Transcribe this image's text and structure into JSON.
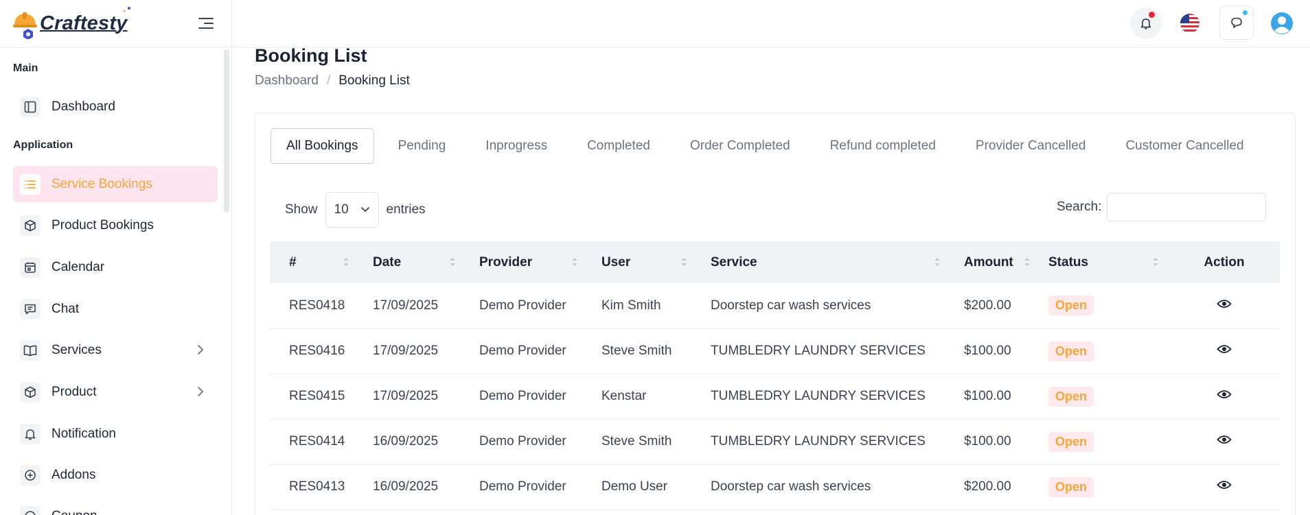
{
  "app": {
    "logo_text": "Craftesty"
  },
  "sidebar": {
    "sections": [
      {
        "label": "Main"
      },
      {
        "label": "Application"
      }
    ],
    "items": [
      {
        "label": "Dashboard",
        "icon": "layout-icon"
      },
      {
        "label": "Service Bookings",
        "icon": "list-icon",
        "active": true
      },
      {
        "label": "Product Bookings",
        "icon": "box-icon"
      },
      {
        "label": "Calendar",
        "icon": "calendar-icon"
      },
      {
        "label": "Chat",
        "icon": "chat-icon"
      },
      {
        "label": "Services",
        "icon": "book-icon",
        "has_children": true
      },
      {
        "label": "Product",
        "icon": "box-icon",
        "has_children": true
      },
      {
        "label": "Notification",
        "icon": "bell-icon"
      },
      {
        "label": "Addons",
        "icon": "plus-circle-icon"
      },
      {
        "label": "Coupon",
        "icon": "coupon-icon"
      }
    ]
  },
  "page": {
    "title": "Booking List",
    "breadcrumb": {
      "home": "Dashboard",
      "separator": "/",
      "current": "Booking List"
    }
  },
  "tabs": [
    "All Bookings",
    "Pending",
    "Inprogress",
    "Completed",
    "Order Completed",
    "Refund completed",
    "Provider Cancelled",
    "Customer Cancelled"
  ],
  "table_controls": {
    "show_label": "Show",
    "page_size": "10",
    "entries_label": "entries",
    "search_label": "Search:"
  },
  "table": {
    "columns": [
      "#",
      "Date",
      "Provider",
      "User",
      "Service",
      "Amount",
      "Status",
      "Action"
    ],
    "rows": [
      {
        "id": "RES0418",
        "date": "17/09/2025",
        "provider": "Demo Provider",
        "user": "Kim Smith",
        "service": "Doorstep car wash services",
        "amount": "$200.00",
        "status": "Open"
      },
      {
        "id": "RES0416",
        "date": "17/09/2025",
        "provider": "Demo Provider",
        "user": "Steve Smith",
        "service": "TUMBLEDRY LAUNDRY SERVICES",
        "amount": "$100.00",
        "status": "Open"
      },
      {
        "id": "RES0415",
        "date": "17/09/2025",
        "provider": "Demo Provider",
        "user": "Kenstar",
        "service": "TUMBLEDRY LAUNDRY SERVICES",
        "amount": "$100.00",
        "status": "Open"
      },
      {
        "id": "RES0414",
        "date": "16/09/2025",
        "provider": "Demo Provider",
        "user": "Steve Smith",
        "service": "TUMBLEDRY LAUNDRY SERVICES",
        "amount": "$100.00",
        "status": "Open"
      },
      {
        "id": "RES0413",
        "date": "16/09/2025",
        "provider": "Demo Provider",
        "user": "Demo User",
        "service": "Doorstep car wash services",
        "amount": "$200.00",
        "status": "Open"
      }
    ]
  },
  "colors": {
    "accent": "#f7a536",
    "active_bg": "#fde4ef",
    "notification_dot": "#e5243b",
    "message_dot": "#3bb8e8"
  }
}
